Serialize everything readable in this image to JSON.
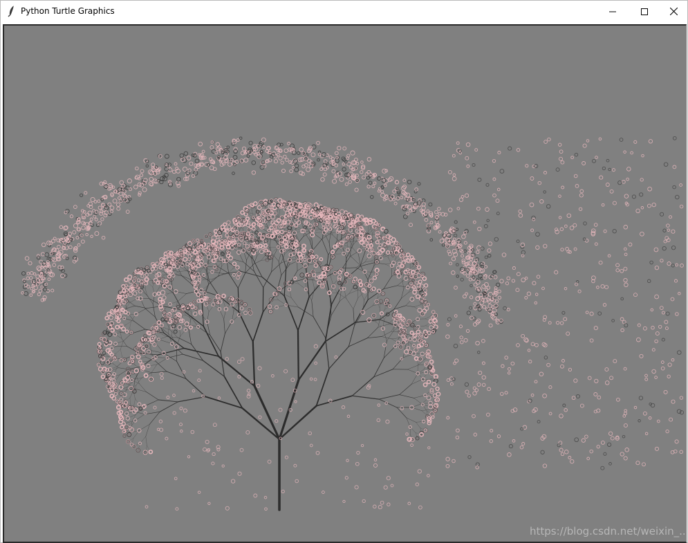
{
  "window": {
    "title": "Python Turtle Graphics",
    "icon": "feather-icon",
    "buttons": {
      "minimize": "minimize-icon",
      "maximize": "maximize-icon",
      "close": "close-icon"
    }
  },
  "canvas": {
    "background_color": "#808080",
    "trunk_color": "#2e2e2e",
    "blossom_color": "#e8b8bd",
    "watermark": "https://blog.csdn.net/weixin_..."
  }
}
